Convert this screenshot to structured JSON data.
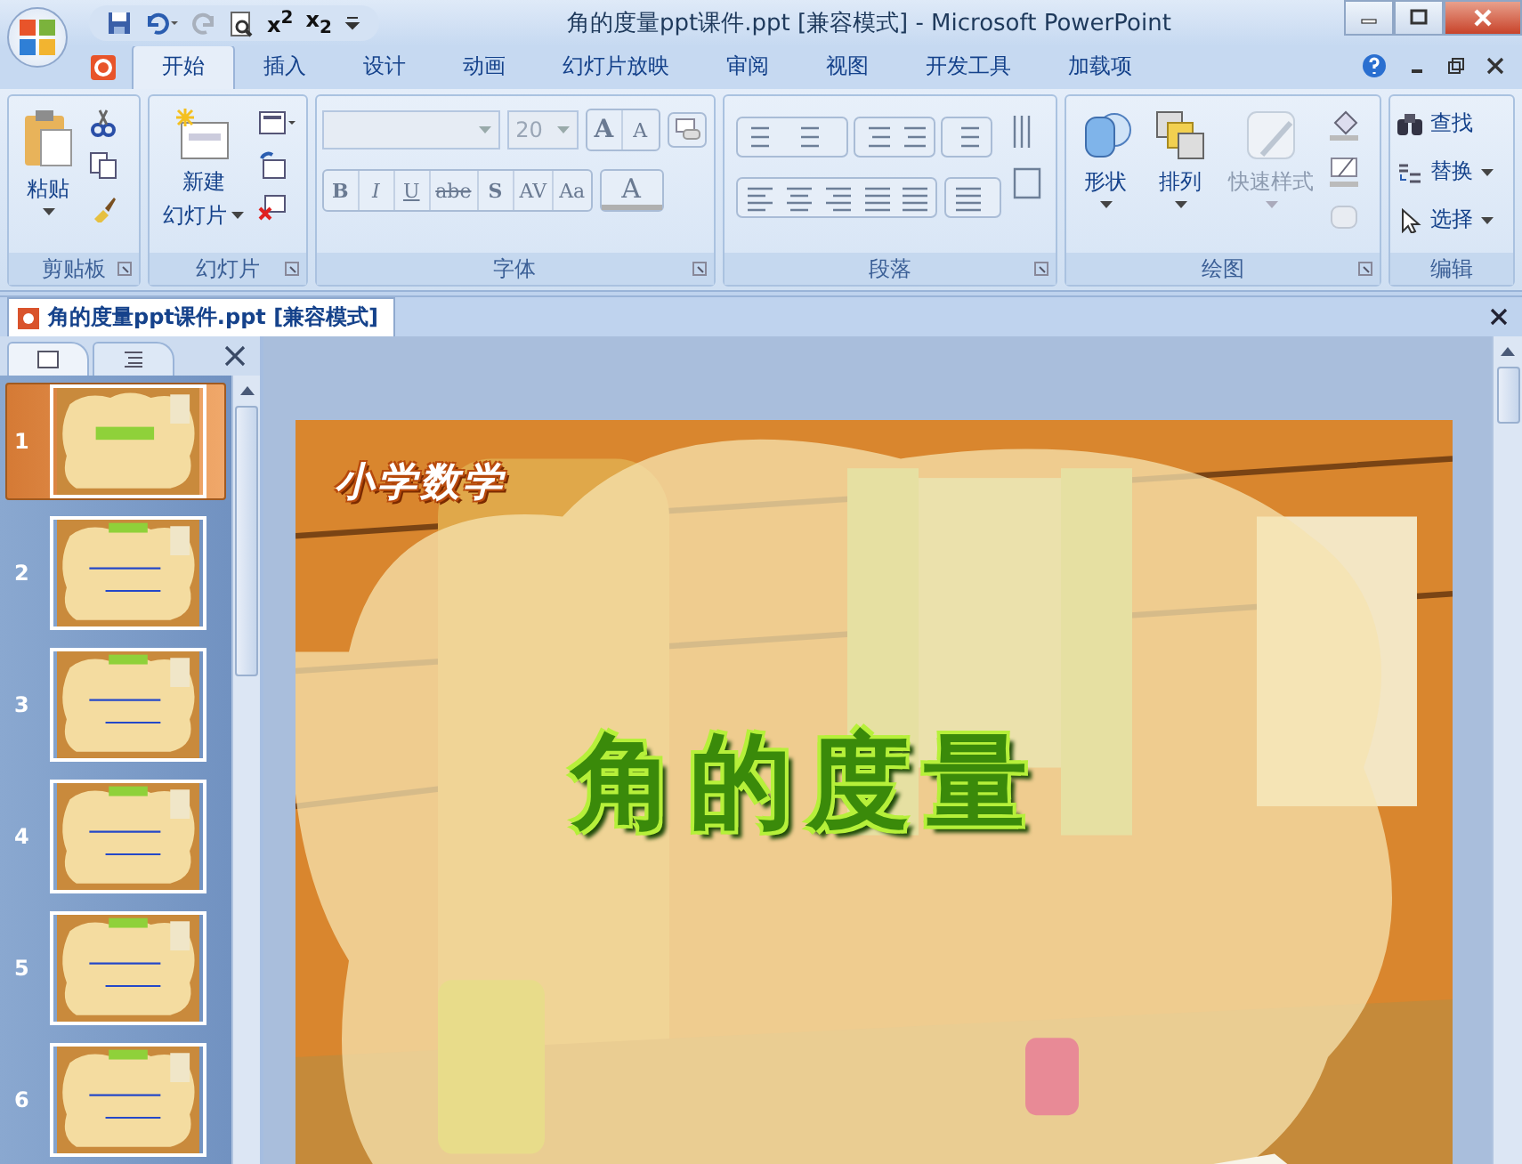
{
  "window": {
    "title": "角的度量ppt课件.ppt [兼容模式] - Microsoft PowerPoint"
  },
  "quick_access": [
    {
      "kind": "save"
    },
    {
      "kind": "undo"
    },
    {
      "kind": "redo"
    },
    {
      "kind": "preview"
    },
    {
      "kind": "text",
      "label": "x$^{2}$"
    },
    {
      "kind": "text",
      "label": "x$_{2}$"
    },
    {
      "kind": "customize"
    }
  ],
  "tabs": [
    {
      "label": "开始",
      "selected": true
    },
    {
      "label": "插入",
      "selected": false
    },
    {
      "label": "设计",
      "selected": false
    },
    {
      "label": "动画",
      "selected": false
    },
    {
      "label": "幻灯片放映",
      "selected": false
    },
    {
      "label": "审阅",
      "selected": false
    },
    {
      "label": "视图",
      "selected": false
    },
    {
      "label": "开发工具",
      "selected": false
    },
    {
      "label": "加载项",
      "selected": false
    }
  ],
  "ribbon": {
    "clipboard": {
      "title": "剪贴板",
      "paste": "粘贴"
    },
    "slides": {
      "title": "幻灯片",
      "new_slide": [
        "新建",
        "幻灯片"
      ]
    },
    "font": {
      "title": "字体",
      "font_name": {
        "disabled": true
      },
      "font_size": {
        "value": "20",
        "disabled": true
      },
      "grow": "A",
      "shrink": "A",
      "buttons": [
        "B",
        "I",
        "U",
        "abe",
        "S",
        "AV",
        "Aa"
      ],
      "color_button": "A"
    },
    "paragraph": {
      "title": "段落"
    },
    "drawing": {
      "title": "绘图",
      "buttons": [
        {
          "label": "形状",
          "kind": "shapes",
          "disabled": false
        },
        {
          "label": "排列",
          "kind": "arrange",
          "disabled": false
        },
        {
          "label": "快速样式",
          "kind": "styles",
          "disabled": true
        }
      ]
    },
    "editing": {
      "title": "编辑",
      "items": [
        {
          "label": "查找",
          "kind": "find",
          "dropdown": false
        },
        {
          "label": "替换",
          "kind": "replace",
          "dropdown": true
        },
        {
          "label": "选择",
          "kind": "select",
          "dropdown": true
        }
      ]
    }
  },
  "document_tab": {
    "title": "角的度量ppt课件.ppt [兼容模式]"
  },
  "slide_panel": {
    "thumbnails": [
      {
        "number": "1",
        "selected": true
      },
      {
        "number": "2",
        "selected": false
      },
      {
        "number": "3",
        "selected": false
      },
      {
        "number": "4",
        "selected": false
      },
      {
        "number": "5",
        "selected": false
      },
      {
        "number": "6",
        "selected": false
      }
    ]
  },
  "slide": {
    "subject": "小学数学",
    "title": "角的度量"
  }
}
